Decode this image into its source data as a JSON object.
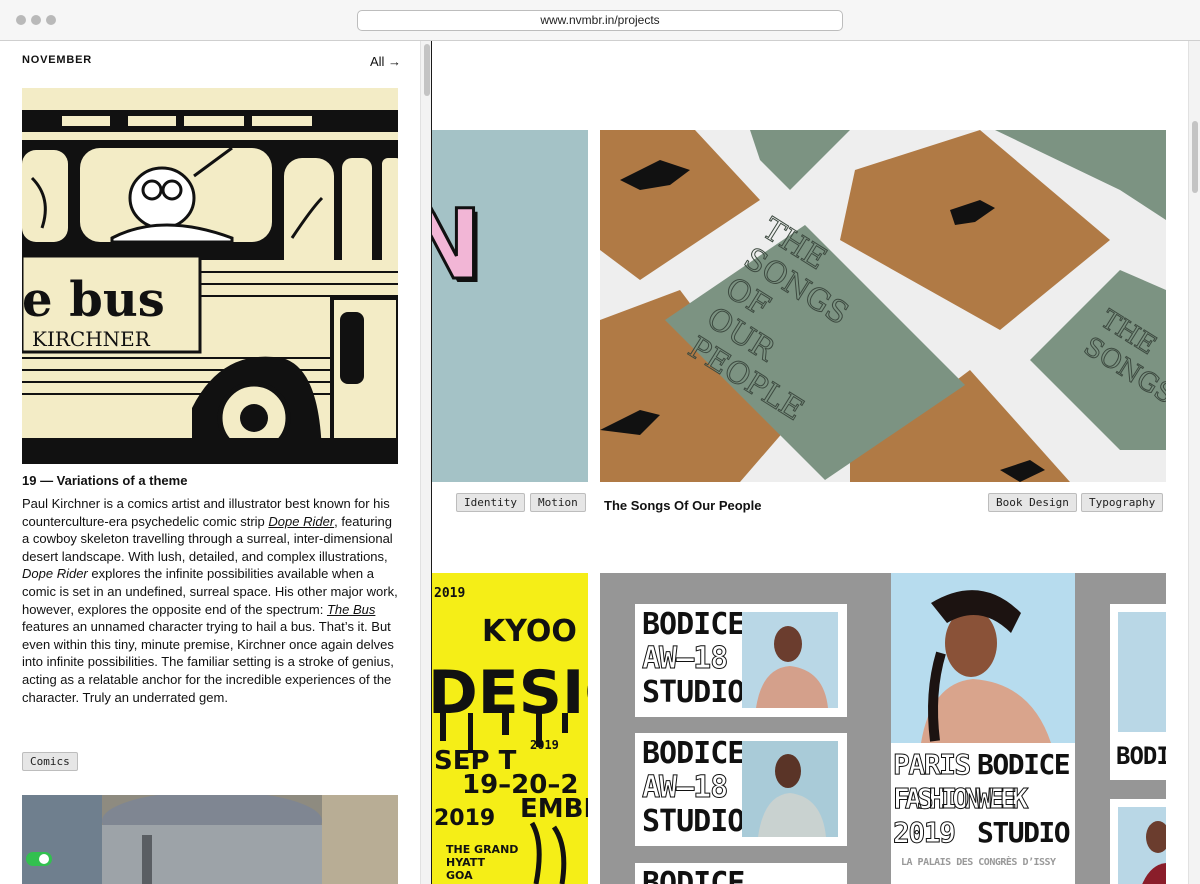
{
  "browser": {
    "url": "www.nvmbr.in/projects"
  },
  "left": {
    "month": "NOVEMBER",
    "all_link": "All →",
    "comic": {
      "title_fragment": "e bus",
      "author": "KIRCHNER"
    },
    "article": {
      "title": "19 — Variations of a theme",
      "p1": "Paul Kirchner is a comics artist and illustrator best known for his counterculture-era psychedelic comic strip ",
      "link1": "Dope Rider",
      "p2": ", featuring a cowboy skeleton travelling through a surreal, inter-dimensional desert landscape. With lush, detailed, and complex illustrations, ",
      "em1": "Dope Rider",
      "p3": " explores the infinite possibilities available when a comic is set in an undefined, surreal space. His other major work, however, explores the opposite end of the spectrum: ",
      "link2": "The Bus",
      "p4": " features an unnamed character trying to hail a bus. That’s it. But even within this tiny, minute premise, Kirchner once again delves into infinite possibilities. The familiar setting is a stroke of genius, acting as a relatable anchor for the incredible experiences of the character. Truly an underrated gem.",
      "tag": "Comics"
    }
  },
  "projects": {
    "row1": {
      "left_tags": [
        "Identity",
        "Motion"
      ],
      "partial_letter": "N",
      "songs": {
        "title": "The Songs Of Our People",
        "tags": [
          "Book Design",
          "Typography"
        ],
        "book_lines": [
          "THE",
          "SONGS",
          "OF",
          "OUR",
          "PEOPLE"
        ],
        "spine": "THE SONGS OF OUR PEOPLE"
      }
    },
    "row2": {
      "kyoo": {
        "year_top": "2019",
        "kyoo": "KYOO",
        "design": "DESIGN",
        "date1": "SEP T",
        "date2": "19–20–2",
        "date3": "EMBE",
        "date4": "2019",
        "venue1": "THE GRAND",
        "venue2": "HYATT",
        "venue3": "GOA",
        "ring": "2019"
      },
      "bodice": {
        "brand": "BODICE",
        "season": "AW—18",
        "studio": "STUDIO",
        "brand_partial": "BODIC"
      },
      "paris": {
        "paris": "PARIS",
        "bodice": "BODICE",
        "fashion": "FASHIONWEEK",
        "year": "2019",
        "studio": "STUDIO",
        "venue": "LA PALAIS DES CONGRÈS D’ISSY"
      }
    }
  },
  "colors": {
    "teal_panel": "#a4c2c6",
    "kraft": "#b07a45",
    "cloth": "#7c9382",
    "kyoo_yellow": "#f5ee17",
    "bodice_gray": "#969696",
    "toggle_green": "#32c04f"
  }
}
